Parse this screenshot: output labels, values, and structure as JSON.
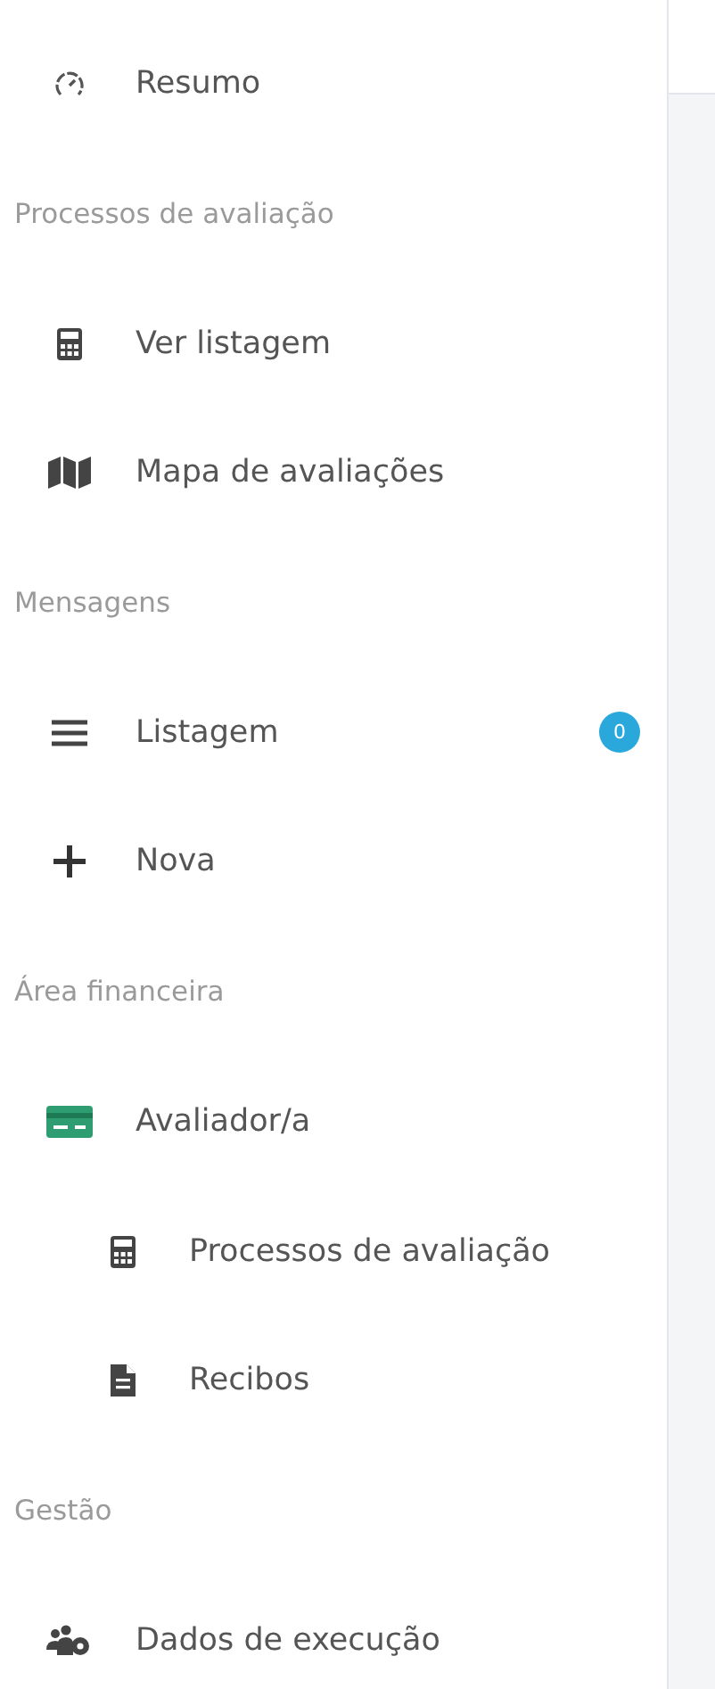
{
  "sidebar": {
    "sections": [
      {
        "items": [
          {
            "label": "Resumo"
          }
        ]
      },
      {
        "heading": "Processos de avaliação",
        "items": [
          {
            "label": "Ver listagem"
          },
          {
            "label": "Mapa de avaliações"
          }
        ]
      },
      {
        "heading": "Mensagens",
        "items": [
          {
            "label": "Listagem",
            "badge": "0",
            "color": "#2aa8dc"
          },
          {
            "label": "Nova"
          }
        ]
      },
      {
        "heading": "Área financeira",
        "items": [
          {
            "label": "Avaliador/a",
            "children": [
              {
                "label": "Processos de avaliação"
              },
              {
                "label": "Recibos"
              }
            ]
          }
        ]
      },
      {
        "heading": "Gestão",
        "items": [
          {
            "label": "Dados de execução"
          }
        ]
      }
    ]
  }
}
